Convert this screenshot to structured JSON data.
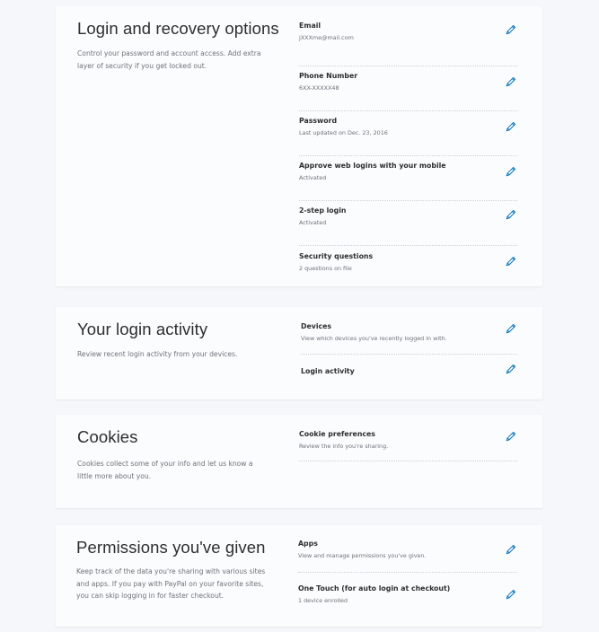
{
  "colors": {
    "page_bg": "#f5f7fa",
    "card_bg": "#fbfcfd",
    "edit_icon": "#0070ba",
    "muted_text": "#6c7378"
  },
  "sections": [
    {
      "title": "Login and recovery options",
      "description": "Control your password and account access. Add extra layer of security if you get locked out.",
      "items": [
        {
          "label": "Email",
          "value": "jXXXme@mail.com",
          "icon": "pencil-icon"
        },
        {
          "label": "Phone Number",
          "value": "6XX-XXXXX48",
          "icon": "pencil-icon"
        },
        {
          "label": "Password",
          "value": "Last updated on Dec. 23, 2016",
          "icon": "pencil-icon"
        },
        {
          "label": "Approve web logins with your mobile",
          "value": "Activated",
          "icon": "pencil-icon"
        },
        {
          "label": "2-step login",
          "value": "Activated",
          "icon": "pencil-icon"
        },
        {
          "label": "Security questions",
          "value": "2 questions on file",
          "icon": "pencil-icon"
        }
      ]
    },
    {
      "title": "Your login activity",
      "description": "Review recent login activity from your devices.",
      "items": [
        {
          "label": "Devices",
          "value": "View which devices you've recently logged in with.",
          "icon": "pencil-icon"
        },
        {
          "label": "Login activity",
          "value": "",
          "icon": "pencil-icon"
        }
      ]
    },
    {
      "title": "Cookies",
      "description": "Cookies collect some of your info and let us know a little more about you.",
      "items": [
        {
          "label": "Cookie preferences",
          "value": "Review the info you're sharing.",
          "icon": "pencil-icon"
        }
      ]
    },
    {
      "title": "Permissions you've given",
      "description": "Keep track of the data you're sharing with various sites and apps. If you pay with PayPal on your favorite sites, you can skip logging in for faster checkout.",
      "items": [
        {
          "label": "Apps",
          "value": "View and manage permissions you've given.",
          "icon": "pencil-icon"
        },
        {
          "label": "One Touch (for auto login at checkout)",
          "value": "1 device enrolled",
          "icon": "pencil-icon"
        }
      ]
    }
  ]
}
